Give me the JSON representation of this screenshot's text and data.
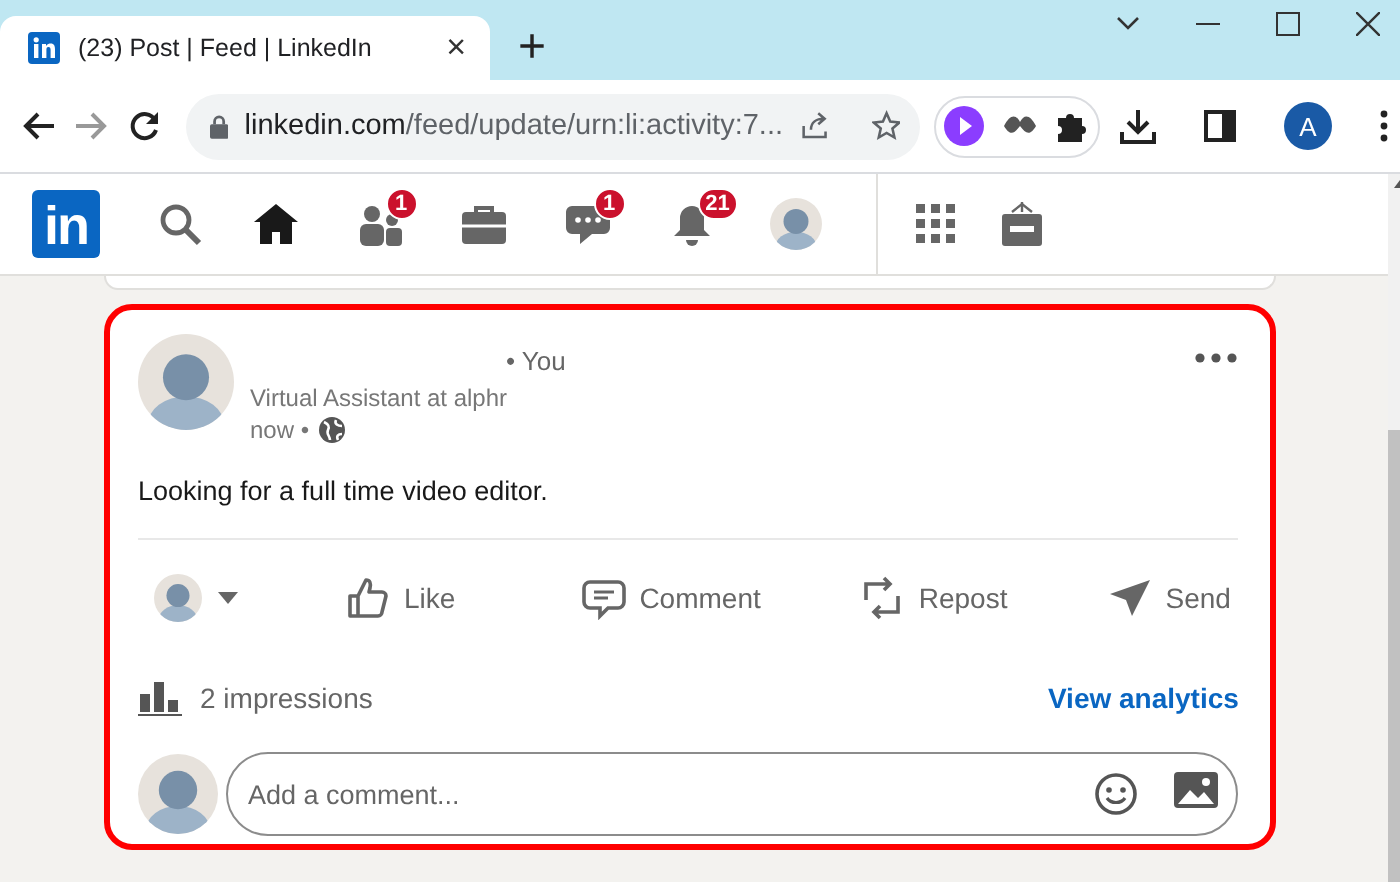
{
  "browser": {
    "tab": {
      "title": "(23) Post | Feed | LinkedIn",
      "close": "×"
    },
    "new_tab": "+",
    "url_host": "linkedin.com",
    "url_path": "/feed/update/urn:li:activity:7...",
    "profile_initial": "A"
  },
  "nav": {
    "logo": "in",
    "items": [
      {
        "kind": "search",
        "selected": false
      },
      {
        "kind": "home",
        "selected": true
      },
      {
        "kind": "network",
        "selected": false,
        "badge": "1"
      },
      {
        "kind": "jobs",
        "selected": false
      },
      {
        "kind": "messaging",
        "selected": false,
        "badge": "1"
      },
      {
        "kind": "notifications",
        "selected": false,
        "badge": "21"
      },
      {
        "kind": "me",
        "selected": false
      },
      {
        "kind": "apps",
        "selected": false
      },
      {
        "kind": "advertise",
        "selected": false
      }
    ]
  },
  "post": {
    "author_suffix": "• You",
    "headline": "Virtual Assistant at alphr",
    "time": "now •",
    "text": "Looking for a full time video editor.",
    "actions": [
      {
        "kind": "like",
        "label": "Like"
      },
      {
        "kind": "comment",
        "label": "Comment"
      },
      {
        "kind": "repost",
        "label": "Repost"
      },
      {
        "kind": "send",
        "label": "Send"
      }
    ],
    "impressions": "2 impressions",
    "analytics_link": "View analytics",
    "comment_placeholder": "Add a comment..."
  }
}
